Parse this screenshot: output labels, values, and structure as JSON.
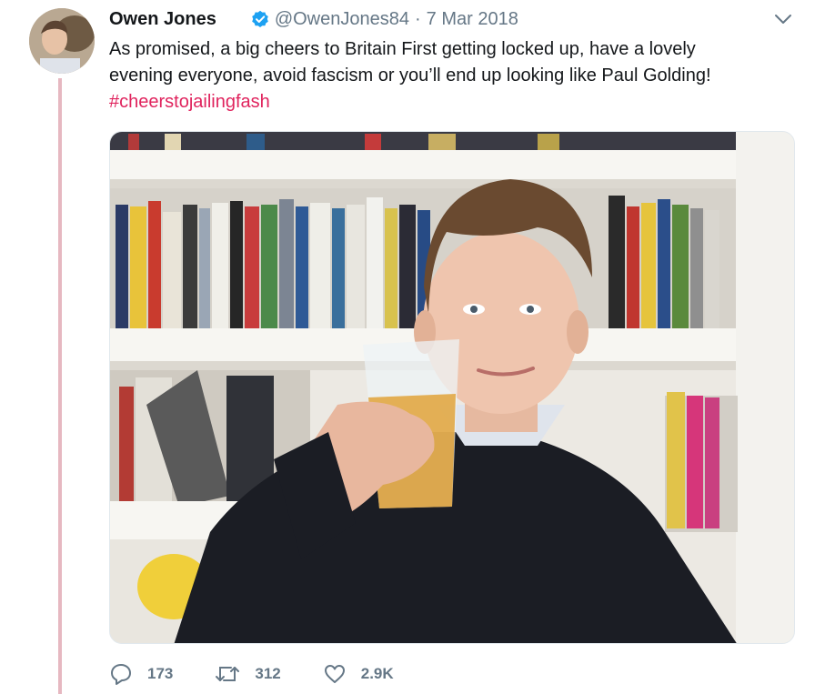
{
  "tweet": {
    "author_name": "Owen Jones",
    "handle": "@OwenJones84",
    "separator": "·",
    "date": "7 Mar 2018",
    "text_lines": [
      "As promised, a big cheers to Britain First getting locked up, have a lovely",
      "evening everyone, avoid fascism or you’ll end up looking like Paul Golding!"
    ],
    "hashtag": "#cheerstojailingfash",
    "colors": {
      "hashtag": "#e0245e",
      "verified": "#1da1f2",
      "thread_line": "#e6b8c1",
      "muted": "#657786"
    }
  },
  "actions": {
    "replies": {
      "icon": "reply-icon",
      "count": "173"
    },
    "retweets": {
      "icon": "retweet-icon",
      "count": "312"
    },
    "likes": {
      "icon": "heart-icon",
      "count": "2.9K"
    }
  },
  "icons": {
    "verified": "verified-badge-icon",
    "menu": "chevron-down-icon"
  }
}
